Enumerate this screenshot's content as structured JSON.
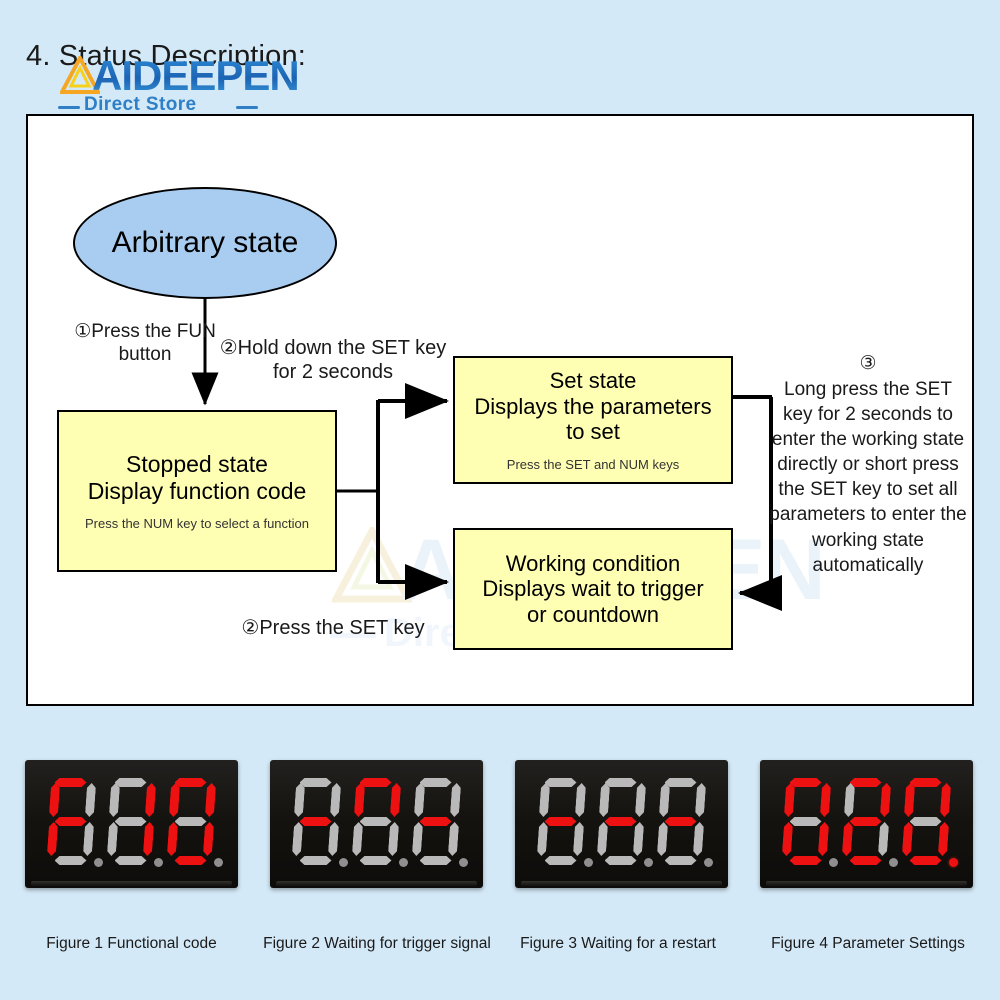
{
  "page": {
    "heading": "4. Status Description:",
    "background_color": "#d4e9f7"
  },
  "logo": {
    "name": "AIDEEPEN",
    "subtitle": "Direct Store",
    "icon": "triangle-a-logo-icon",
    "color": "#2f7fc6"
  },
  "diagram": {
    "start_node": {
      "label": "Arbitrary state",
      "shape": "ellipse",
      "fill": "#a9cdf0"
    },
    "nodes": [
      {
        "id": "stopped",
        "title": "Stopped state",
        "line2": "Display function code",
        "hint": "Press the NUM key to select a function",
        "fill": "#ffffb4"
      },
      {
        "id": "set",
        "title": "Set state",
        "line2": "Displays the parameters",
        "line3": "to set",
        "hint": "Press the SET and NUM keys",
        "fill": "#ffffb4"
      },
      {
        "id": "working",
        "title": "Working condition",
        "line2": "Displays wait to trigger",
        "line3": "or countdown",
        "fill": "#ffffb4"
      }
    ],
    "labels": {
      "step1": "①Press the FUN button",
      "step2a": "②Hold down the SET key for 2 seconds",
      "step2b": "②Press the SET key",
      "step3_number": "③",
      "step3_text": "Long press the SET key for 2 seconds to enter the working state directly or short press the SET key to set all parameters to enter the working state automatically"
    }
  },
  "displays": [
    {
      "id": "figure1",
      "caption": "Figure 1 Functional code",
      "reading": "F1.0",
      "digits": [
        {
          "segments": {
            "a": true,
            "b": false,
            "c": false,
            "d": false,
            "e": true,
            "f": true,
            "g": true
          },
          "dp": false
        },
        {
          "segments": {
            "a": false,
            "b": true,
            "c": true,
            "d": false,
            "e": false,
            "f": false,
            "g": false
          },
          "dp": false
        },
        {
          "segments": {
            "a": true,
            "b": true,
            "c": true,
            "d": true,
            "e": true,
            "f": true,
            "g": false
          },
          "dp": false
        }
      ]
    },
    {
      "id": "figure2",
      "caption": "Figure 2 Waiting for trigger signal",
      "reading": "-∏-",
      "digits": [
        {
          "segments": {
            "a": false,
            "b": false,
            "c": false,
            "d": false,
            "e": false,
            "f": false,
            "g": true
          },
          "dp": false
        },
        {
          "segments": {
            "a": true,
            "b": true,
            "c": false,
            "d": false,
            "e": false,
            "f": true,
            "g": false
          },
          "dp": false
        },
        {
          "segments": {
            "a": false,
            "b": false,
            "c": false,
            "d": false,
            "e": false,
            "f": false,
            "g": true
          },
          "dp": false
        }
      ]
    },
    {
      "id": "figure3",
      "caption": "Figure 3 Waiting for a restart",
      "reading": "---",
      "digits": [
        {
          "segments": {
            "a": false,
            "b": false,
            "c": false,
            "d": false,
            "e": false,
            "f": false,
            "g": true
          },
          "dp": false
        },
        {
          "segments": {
            "a": false,
            "b": false,
            "c": false,
            "d": false,
            "e": false,
            "f": false,
            "g": true
          },
          "dp": false
        },
        {
          "segments": {
            "a": false,
            "b": false,
            "c": false,
            "d": false,
            "e": false,
            "f": false,
            "g": true
          },
          "dp": false
        }
      ]
    },
    {
      "id": "figure4",
      "caption": "Figure 4 Parameter Settings",
      "reading": "02.0",
      "digits": [
        {
          "segments": {
            "a": true,
            "b": true,
            "c": true,
            "d": true,
            "e": true,
            "f": true,
            "g": false
          },
          "dp": false
        },
        {
          "segments": {
            "a": true,
            "b": true,
            "c": false,
            "d": true,
            "e": true,
            "f": false,
            "g": true
          },
          "dp": false
        },
        {
          "segments": {
            "a": true,
            "b": true,
            "c": true,
            "d": true,
            "e": true,
            "f": true,
            "g": false
          },
          "dp": true
        }
      ]
    }
  ]
}
